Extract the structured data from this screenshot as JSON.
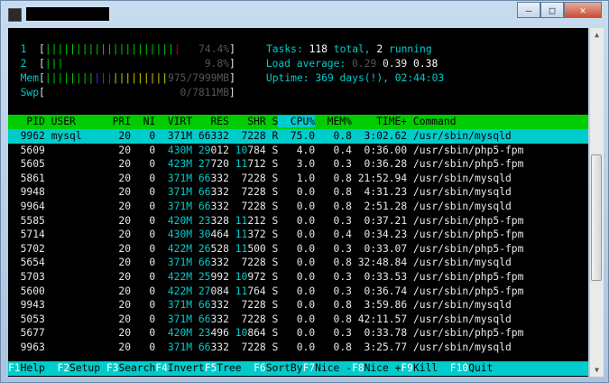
{
  "window": {
    "controls": [
      "—",
      "□",
      "✕"
    ]
  },
  "meters": {
    "cpu1": {
      "label": "1",
      "percent": 74.4,
      "text": "74.4%"
    },
    "cpu2": {
      "label": "2",
      "percent": 9.8,
      "text": "9.8%"
    },
    "mem": {
      "label": "Mem",
      "text": "975/7999MB"
    },
    "swp": {
      "label": "Swp",
      "text": "0/7811MB"
    }
  },
  "summary": {
    "tasks_label": "Tasks: ",
    "tasks_total": "118",
    "tasks_total_label": " total, ",
    "tasks_running": "2",
    "tasks_running_label": " running",
    "load_label": "Load average: ",
    "load1": "0.29",
    "load5": "0.39",
    "load15": "0.38",
    "uptime_label": "Uptime: ",
    "uptime": "369 days(!), 02:44:03"
  },
  "table": {
    "columns": [
      "PID",
      "USER",
      "PRI",
      "NI",
      "VIRT",
      "RES",
      "SHR",
      "S",
      "CPU%",
      "MEM%",
      "TIME+",
      "Command"
    ],
    "sort_column": "CPU%",
    "rows": [
      [
        "9962",
        "mysql",
        "20",
        "0",
        "371M",
        "66332",
        "7228",
        "R",
        "75.0",
        "0.8",
        "3:02.62",
        "/usr/sbin/mysqld"
      ],
      [
        "5609",
        "",
        "20",
        "0",
        "430M",
        "29012",
        "10784",
        "S",
        "4.0",
        "0.4",
        "0:36.00",
        "/usr/sbin/php5-fpm"
      ],
      [
        "5605",
        "",
        "20",
        "0",
        "423M",
        "27720",
        "11712",
        "S",
        "3.0",
        "0.3",
        "0:36.28",
        "/usr/sbin/php5-fpm"
      ],
      [
        "5861",
        "",
        "20",
        "0",
        "371M",
        "66332",
        "7228",
        "S",
        "1.0",
        "0.8",
        "21:52.94",
        "/usr/sbin/mysqld"
      ],
      [
        "9948",
        "",
        "20",
        "0",
        "371M",
        "66332",
        "7228",
        "S",
        "0.0",
        "0.8",
        "4:31.23",
        "/usr/sbin/mysqld"
      ],
      [
        "9964",
        "",
        "20",
        "0",
        "371M",
        "66332",
        "7228",
        "S",
        "0.0",
        "0.8",
        "2:51.28",
        "/usr/sbin/mysqld"
      ],
      [
        "5585",
        "",
        "20",
        "0",
        "420M",
        "23328",
        "11212",
        "S",
        "0.0",
        "0.3",
        "0:37.21",
        "/usr/sbin/php5-fpm"
      ],
      [
        "5714",
        "",
        "20",
        "0",
        "430M",
        "30464",
        "11372",
        "S",
        "0.0",
        "0.4",
        "0:34.23",
        "/usr/sbin/php5-fpm"
      ],
      [
        "5702",
        "",
        "20",
        "0",
        "422M",
        "26528",
        "11500",
        "S",
        "0.0",
        "0.3",
        "0:33.07",
        "/usr/sbin/php5-fpm"
      ],
      [
        "5654",
        "",
        "20",
        "0",
        "371M",
        "66332",
        "7228",
        "S",
        "0.0",
        "0.8",
        "32:48.84",
        "/usr/sbin/mysqld"
      ],
      [
        "5703",
        "",
        "20",
        "0",
        "422M",
        "25992",
        "10972",
        "S",
        "0.0",
        "0.3",
        "0:33.53",
        "/usr/sbin/php5-fpm"
      ],
      [
        "5600",
        "",
        "20",
        "0",
        "422M",
        "27084",
        "11764",
        "S",
        "0.0",
        "0.3",
        "0:36.74",
        "/usr/sbin/php5-fpm"
      ],
      [
        "9943",
        "",
        "20",
        "0",
        "371M",
        "66332",
        "7228",
        "S",
        "0.0",
        "0.8",
        "3:59.86",
        "/usr/sbin/mysqld"
      ],
      [
        "5053",
        "",
        "20",
        "0",
        "371M",
        "66332",
        "7228",
        "S",
        "0.0",
        "0.8",
        "42:11.57",
        "/usr/sbin/mysqld"
      ],
      [
        "5677",
        "",
        "20",
        "0",
        "420M",
        "23496",
        "10864",
        "S",
        "0.0",
        "0.3",
        "0:33.78",
        "/usr/sbin/php5-fpm"
      ],
      [
        "9963",
        "",
        "20",
        "0",
        "371M",
        "66332",
        "7228",
        "S",
        "0.0",
        "0.8",
        "3:25.77",
        "/usr/sbin/mysqld"
      ]
    ]
  },
  "fkeys": [
    {
      "key": "F1",
      "label": "Help  "
    },
    {
      "key": "F2",
      "label": "Setup "
    },
    {
      "key": "F3",
      "label": "Search"
    },
    {
      "key": "F4",
      "label": "Invert"
    },
    {
      "key": "F5",
      "label": "Tree  "
    },
    {
      "key": "F6",
      "label": "SortBy"
    },
    {
      "key": "F7",
      "label": "Nice -"
    },
    {
      "key": "F8",
      "label": "Nice +"
    },
    {
      "key": "F9",
      "label": "Kill  "
    },
    {
      "key": "F10",
      "label": "Quit"
    }
  ]
}
